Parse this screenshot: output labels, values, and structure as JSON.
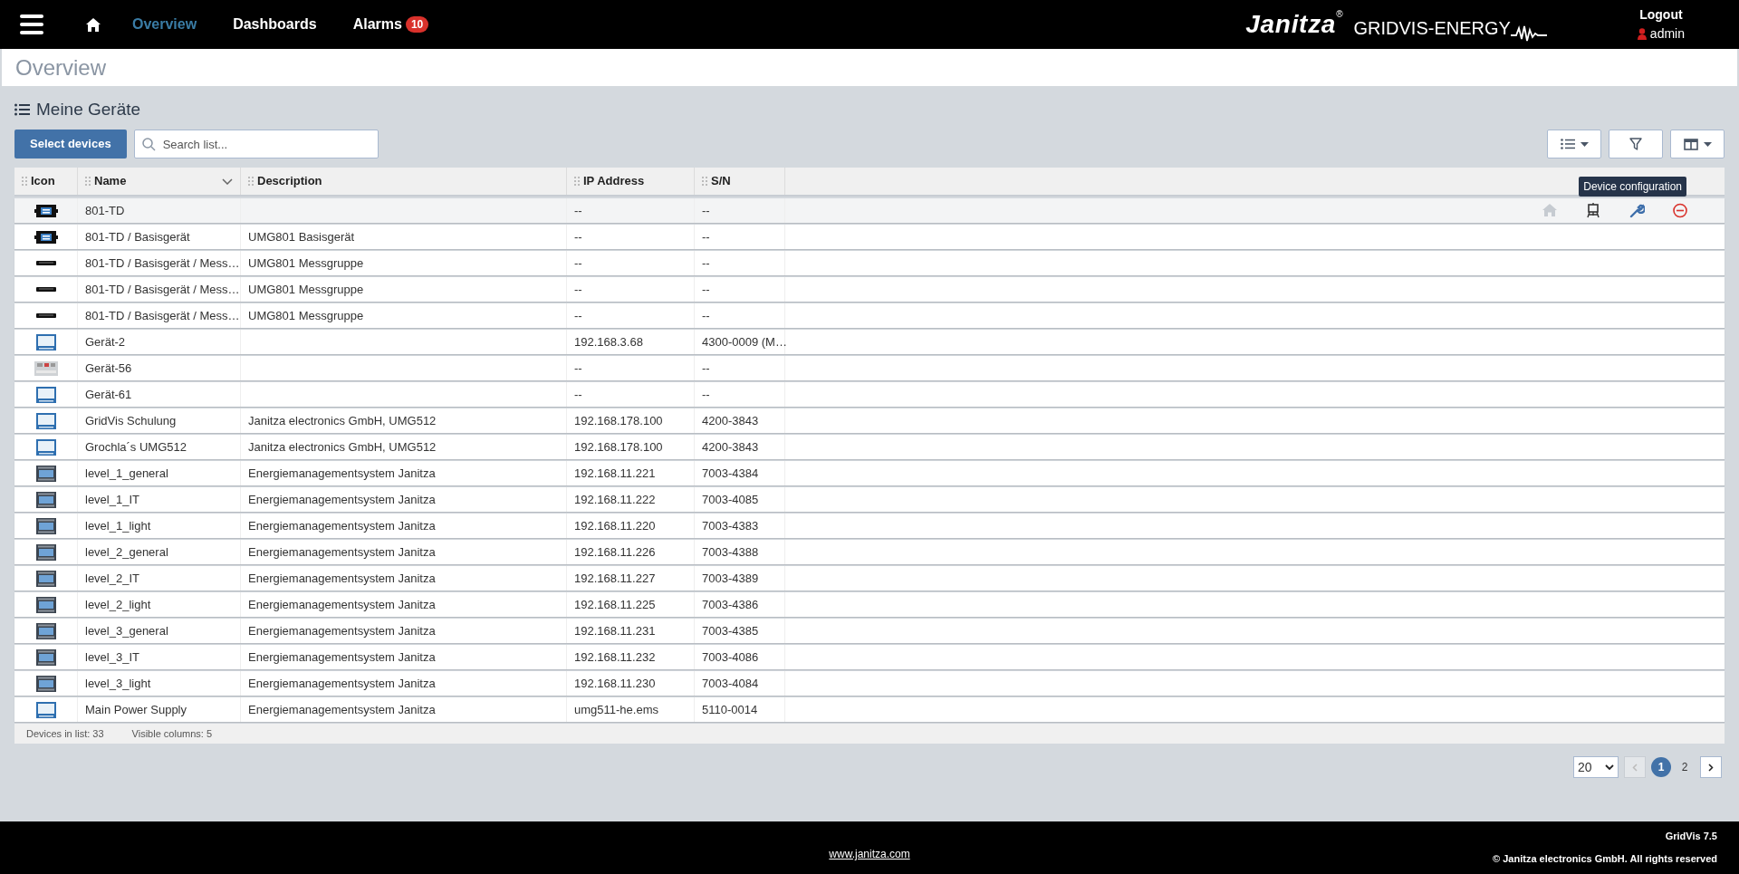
{
  "nav": {
    "items": [
      {
        "label": "Overview",
        "selected": true
      },
      {
        "label": "Dashboards",
        "selected": false
      },
      {
        "label": "Alarms",
        "selected": false,
        "badge": "10"
      }
    ],
    "brand": {
      "logo": "Janitza",
      "mark": "®",
      "product": "GRIDVIS-ENERGY"
    },
    "user": {
      "logout": "Logout",
      "name": "admin"
    }
  },
  "page_title": "Overview",
  "section_title": "Meine Geräte",
  "toolbar": {
    "select_button": "Select devices",
    "search": {
      "placeholder": "Search list..."
    }
  },
  "table": {
    "columns": [
      {
        "label": "Icon",
        "sorted": false
      },
      {
        "label": "Name",
        "sorted": true
      },
      {
        "label": "Description",
        "sorted": false
      },
      {
        "label": "IP Address",
        "sorted": false
      },
      {
        "label": "S/N",
        "sorted": false
      }
    ],
    "tooltip": "Device configuration",
    "hover_actions": [
      {
        "kind": "home",
        "disabled": true
      },
      {
        "kind": "device",
        "disabled": false
      },
      {
        "kind": "wrench",
        "disabled": false
      },
      {
        "kind": "remove",
        "disabled": false
      }
    ],
    "rows": [
      {
        "kind": "din",
        "name": "801-TD",
        "description": "",
        "ip": "--",
        "sn": "--",
        "hovered": true
      },
      {
        "kind": "din",
        "name": "801-TD / Basisgerät",
        "description": "UMG801 Basisgerät",
        "ip": "--",
        "sn": "--",
        "hovered": false
      },
      {
        "kind": "strip",
        "name": "801-TD / Basisgerät / Mess…",
        "description": "UMG801 Messgruppe",
        "ip": "--",
        "sn": "--",
        "hovered": false
      },
      {
        "kind": "strip",
        "name": "801-TD / Basisgerät / Mess…",
        "description": "UMG801 Messgruppe",
        "ip": "--",
        "sn": "--",
        "hovered": false
      },
      {
        "kind": "strip",
        "name": "801-TD / Basisgerät / Mess…",
        "description": "UMG801 Messgruppe",
        "ip": "--",
        "sn": "--",
        "hovered": false
      },
      {
        "kind": "panel",
        "name": "Gerät-2",
        "description": "",
        "ip": "192.168.3.68",
        "sn": "4300-0009 (M…",
        "hovered": false
      },
      {
        "kind": "grey",
        "name": "Gerät-56",
        "description": "",
        "ip": "--",
        "sn": "--",
        "hovered": false
      },
      {
        "kind": "panel",
        "name": "Gerät-61",
        "description": "",
        "ip": "--",
        "sn": "--",
        "hovered": false
      },
      {
        "kind": "panel",
        "name": "GridVis Schulung",
        "description": "Janitza electronics GmbH, UMG512",
        "ip": "192.168.178.100",
        "sn": "4200-3843",
        "hovered": false
      },
      {
        "kind": "panel",
        "name": "Grochla´s UMG512",
        "description": "Janitza electronics GmbH, UMG512",
        "ip": "192.168.178.100",
        "sn": "4200-3843",
        "hovered": false
      },
      {
        "kind": "rack",
        "name": "level_1_general",
        "description": "Energiemanagementsystem Janitza",
        "ip": "192.168.11.221",
        "sn": "7003-4384",
        "hovered": false
      },
      {
        "kind": "rack",
        "name": "level_1_IT",
        "description": "Energiemanagementsystem Janitza",
        "ip": "192.168.11.222",
        "sn": "7003-4085",
        "hovered": false
      },
      {
        "kind": "rack",
        "name": "level_1_light",
        "description": "Energiemanagementsystem Janitza",
        "ip": "192.168.11.220",
        "sn": "7003-4383",
        "hovered": false
      },
      {
        "kind": "rack",
        "name": "level_2_general",
        "description": "Energiemanagementsystem Janitza",
        "ip": "192.168.11.226",
        "sn": "7003-4388",
        "hovered": false
      },
      {
        "kind": "rack",
        "name": "level_2_IT",
        "description": "Energiemanagementsystem Janitza",
        "ip": "192.168.11.227",
        "sn": "7003-4389",
        "hovered": false
      },
      {
        "kind": "rack",
        "name": "level_2_light",
        "description": "Energiemanagementsystem Janitza",
        "ip": "192.168.11.225",
        "sn": "7003-4386",
        "hovered": false
      },
      {
        "kind": "rack",
        "name": "level_3_general",
        "description": "Energiemanagementsystem Janitza",
        "ip": "192.168.11.231",
        "sn": "7003-4385",
        "hovered": false
      },
      {
        "kind": "rack",
        "name": "level_3_IT",
        "description": "Energiemanagementsystem Janitza",
        "ip": "192.168.11.232",
        "sn": "7003-4086",
        "hovered": false
      },
      {
        "kind": "rack",
        "name": "level_3_light",
        "description": "Energiemanagementsystem Janitza",
        "ip": "192.168.11.230",
        "sn": "7003-4084",
        "hovered": false
      },
      {
        "kind": "panel",
        "name": "Main Power Supply",
        "description": "Energiemanagementsystem Janitza",
        "ip": "umg511-he.ems",
        "sn": "5110-0014",
        "hovered": false
      }
    ],
    "status": [
      {
        "label": "Devices in list:",
        "value": "33"
      },
      {
        "label": "Visible columns:",
        "value": "5"
      }
    ]
  },
  "pagination": {
    "page_size": "20",
    "prev_disabled": true,
    "pages": [
      {
        "label": "1",
        "selected": true
      },
      {
        "label": "2",
        "selected": false
      }
    ]
  },
  "footer": {
    "link": "www.janitza.com",
    "version": "GridVis 7.5",
    "copyright": "© Janitza electronics GmbH. All rights reserved"
  }
}
